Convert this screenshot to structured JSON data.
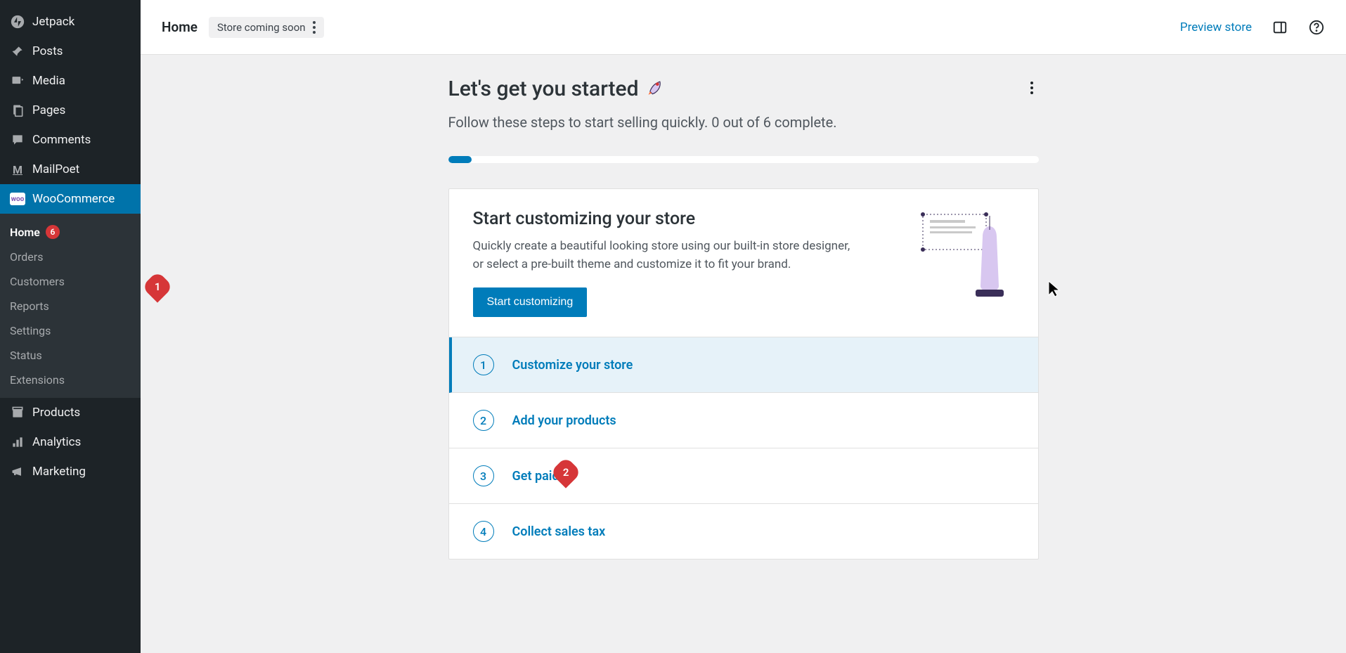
{
  "sidebar": {
    "top": [
      {
        "id": "jetpack",
        "label": "Jetpack",
        "icon": "jetpack-icon"
      },
      {
        "id": "posts",
        "label": "Posts",
        "icon": "pin-icon"
      },
      {
        "id": "media",
        "label": "Media",
        "icon": "media-icon"
      },
      {
        "id": "pages",
        "label": "Pages",
        "icon": "pages-icon"
      },
      {
        "id": "comments",
        "label": "Comments",
        "icon": "comment-icon"
      },
      {
        "id": "mailpoet",
        "label": "MailPoet",
        "icon": "mailpoet-icon"
      }
    ],
    "woo": {
      "label": "WooCommerce"
    },
    "woo_sub": [
      {
        "id": "home",
        "label": "Home",
        "badge": "6",
        "active": true
      },
      {
        "id": "orders",
        "label": "Orders"
      },
      {
        "id": "customers",
        "label": "Customers"
      },
      {
        "id": "reports",
        "label": "Reports"
      },
      {
        "id": "settings",
        "label": "Settings"
      },
      {
        "id": "status",
        "label": "Status"
      },
      {
        "id": "extensions",
        "label": "Extensions"
      }
    ],
    "bottom": [
      {
        "id": "products",
        "label": "Products",
        "icon": "products-icon"
      },
      {
        "id": "analytics",
        "label": "Analytics",
        "icon": "analytics-icon"
      },
      {
        "id": "marketing",
        "label": "Marketing",
        "icon": "megaphone-icon"
      }
    ]
  },
  "topbar": {
    "title": "Home",
    "status": "Store coming soon",
    "preview": "Preview store"
  },
  "page": {
    "title": "Let's get you started",
    "subtitle": "Follow these steps to start selling quickly. 0 out of 6 complete.",
    "progress_percent": 4
  },
  "featured": {
    "title": "Start customizing your store",
    "desc": "Quickly create a beautiful looking store using our built-in store designer, or select a pre-built theme and customize it to fit your brand.",
    "cta": "Start customizing"
  },
  "tasks": [
    {
      "num": "1",
      "label": "Customize your store",
      "active": true
    },
    {
      "num": "2",
      "label": "Add your products"
    },
    {
      "num": "3",
      "label": "Get paid",
      "annotation": "2"
    },
    {
      "num": "4",
      "label": "Collect sales tax"
    }
  ],
  "annotations": {
    "sidebar_woo": "1"
  },
  "colors": {
    "accent": "#007cba",
    "danger": "#d63638",
    "sidebar_bg": "#1d2327"
  }
}
